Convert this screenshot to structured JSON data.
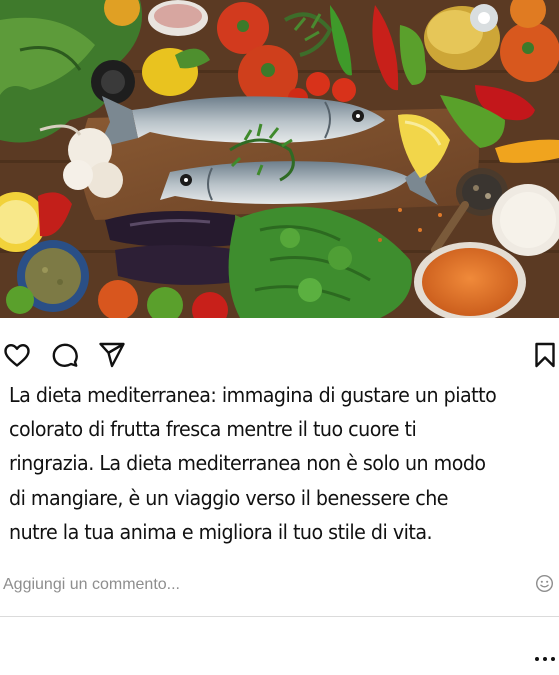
{
  "post": {
    "caption_lines": [
      "La dieta mediterranea: immagina di gustare un piatto",
      "colorato di frutta fresca mentre il tuo cuore ti",
      "ringrazia. La dieta mediterranea non è solo un modo",
      "di mangiare, è un viaggio verso il benessere che",
      "nutre la tua anima e migliora il tuo stile di vita."
    ]
  },
  "actions": {
    "like_icon": "heart-outline-icon",
    "comment_icon": "comment-bubble-icon",
    "share_icon": "paper-plane-icon",
    "save_icon": "bookmark-outline-icon"
  },
  "comment": {
    "placeholder": "Aggiungi un commento...",
    "emoji_icon": "smiley-icon"
  },
  "menu": {
    "more_icon": "more-dots-icon"
  },
  "colors": {
    "text": "#111111",
    "muted": "#8e8e8e",
    "divider": "#dbdbdb"
  }
}
